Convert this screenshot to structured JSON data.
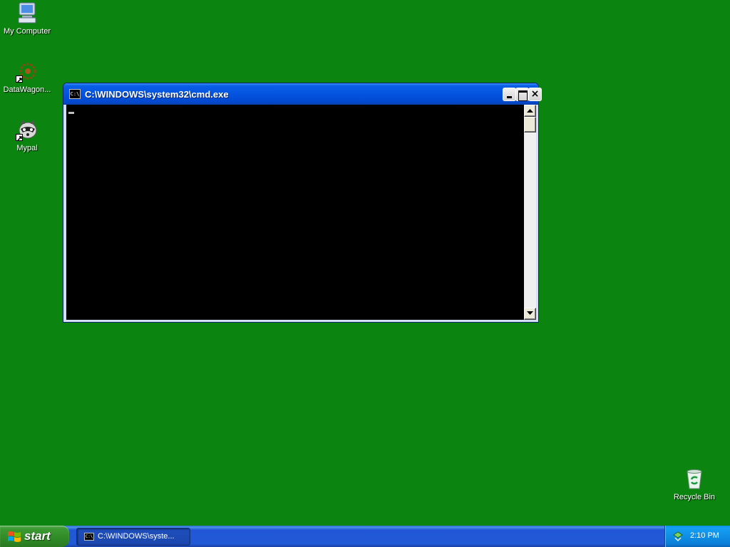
{
  "desktop": {
    "background": "#0b8410",
    "icons": [
      {
        "label": "My Computer",
        "icon": "my-computer-icon"
      },
      {
        "label": "DataWagon...",
        "icon": "datawagon-icon"
      },
      {
        "label": "Mypal",
        "icon": "mypal-raccoon-icon"
      },
      {
        "label": "Recycle Bin",
        "icon": "recycle-bin-icon"
      }
    ]
  },
  "window": {
    "title": "C:\\WINDOWS\\system32\\cmd.exe",
    "app_icon_text": "C:\\",
    "close_glyph": "×",
    "console_background": "#000000"
  },
  "taskbar": {
    "start_label": "start",
    "task_button_label": "C:\\WINDOWS\\syste...",
    "clock": "2:10 PM",
    "accent": "#2259d5"
  }
}
